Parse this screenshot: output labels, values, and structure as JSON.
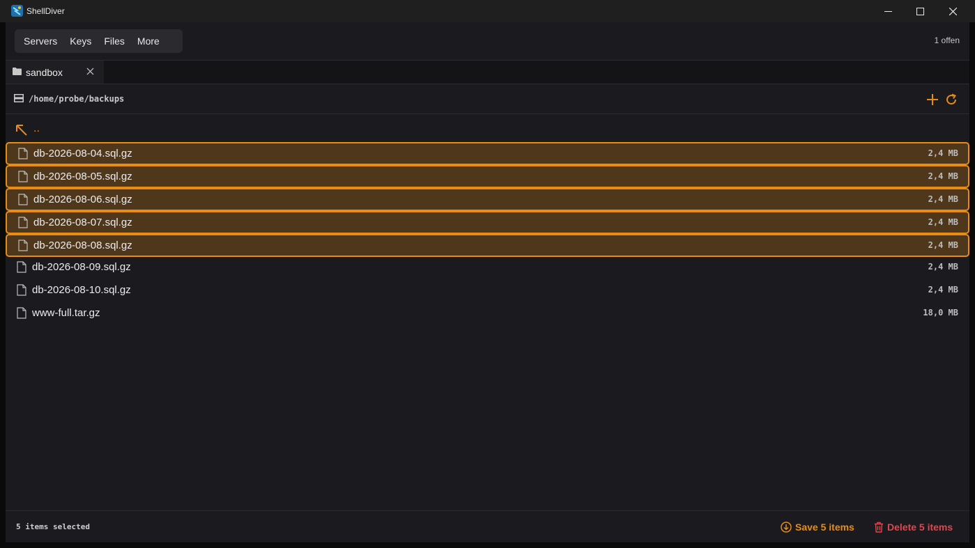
{
  "window": {
    "title": "ShellDiver"
  },
  "nav": {
    "items": [
      {
        "label": "Servers"
      },
      {
        "label": "Keys"
      },
      {
        "label": "Files"
      },
      {
        "label": "More"
      }
    ],
    "open_count": "1 offen"
  },
  "tab": {
    "label": "sandbox",
    "icon": "folder-icon"
  },
  "pathbar": {
    "path": "/home/probe/backups",
    "icon": "server-icon"
  },
  "parent": {
    "label": ".."
  },
  "files": [
    {
      "name": "db-2026-08-04.sql.gz",
      "size": "2,4 MB",
      "selected": true
    },
    {
      "name": "db-2026-08-05.sql.gz",
      "size": "2,4 MB",
      "selected": true
    },
    {
      "name": "db-2026-08-06.sql.gz",
      "size": "2,4 MB",
      "selected": true
    },
    {
      "name": "db-2026-08-07.sql.gz",
      "size": "2,4 MB",
      "selected": true
    },
    {
      "name": "db-2026-08-08.sql.gz",
      "size": "2,4 MB",
      "selected": true
    },
    {
      "name": "db-2026-08-09.sql.gz",
      "size": "2,4 MB",
      "selected": false
    },
    {
      "name": "db-2026-08-10.sql.gz",
      "size": "2,4 MB",
      "selected": false
    },
    {
      "name": "www-full.tar.gz",
      "size": "18,0 MB",
      "selected": false
    }
  ],
  "footer": {
    "selection_text": "5 items selected",
    "save_label": "Save 5 items",
    "delete_label": "Delete 5 items"
  },
  "colors": {
    "accent": "#e98c13",
    "selected_bg": "#4f371c",
    "danger": "#e0464f",
    "background": "#1b1b1f"
  }
}
